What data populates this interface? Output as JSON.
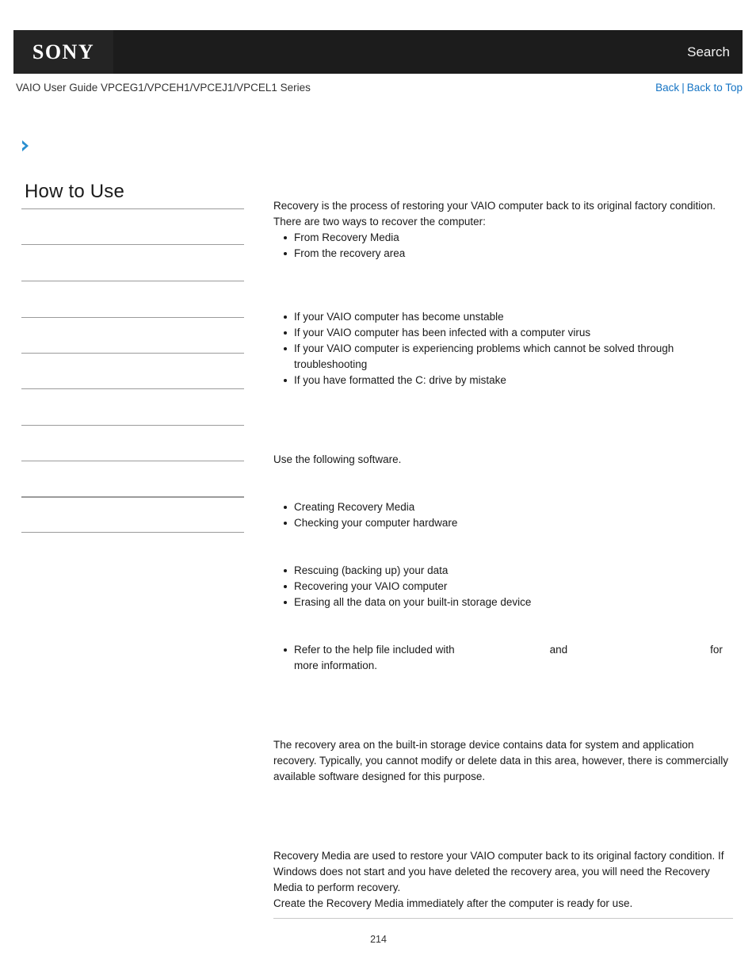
{
  "header": {
    "logo": "SONY",
    "search_label": "Search",
    "logo_icon": "sony-logo"
  },
  "subheader": {
    "guide_title": "VAIO User Guide VPCEG1/VPCEH1/VPCEJ1/VPCEL1 Series",
    "back_label": "Back",
    "separator": "|",
    "back_to_top_label": "Back to Top"
  },
  "breadcrumb": {
    "icon": "chevron-right-icon",
    "text": "",
    "accent_color": "#2a8fd0"
  },
  "sidebar": {
    "heading": "How to Use",
    "items": [
      {
        "label": "",
        "thick": false
      },
      {
        "label": "",
        "thick": false
      },
      {
        "label": "",
        "thick": false
      },
      {
        "label": "",
        "thick": false
      },
      {
        "label": "",
        "thick": false
      },
      {
        "label": "",
        "thick": false
      },
      {
        "label": "",
        "thick": false
      },
      {
        "label": "",
        "thick": false
      },
      {
        "label": "",
        "thick": true
      },
      {
        "label": "",
        "thick": false
      }
    ]
  },
  "content": {
    "intro": {
      "line1": "Recovery is the process of restoring your VAIO computer back to its original factory condition.",
      "line2": "There are two ways to recover the computer:",
      "bullets": [
        "From Recovery Media",
        "From the recovery area"
      ]
    },
    "when_section": {
      "title": "",
      "bullets": [
        "If your VAIO computer has become unstable",
        "If your VAIO computer has been infected with a computer virus",
        "If your VAIO computer is experiencing problems which cannot be solved through troubleshooting",
        "If you have formatted the C: drive by mistake"
      ]
    },
    "software_section": {
      "title": "",
      "lead": "Use the following software.",
      "group1_title": "",
      "group1_bullets": [
        "Creating Recovery Media",
        "Checking your computer hardware"
      ],
      "group2_title": "",
      "group2_bullets": [
        "Rescuing (backing up) your data",
        "Recovering your VAIO computer",
        "Erasing all the data on your built-in storage device"
      ],
      "note_title": "",
      "note_prefix": "Refer to the help file included with",
      "note_blank1": "",
      "note_conjunction": "and",
      "note_blank2": "",
      "note_suffix": "for more information."
    },
    "recovery_area_section": {
      "title": "",
      "text": "The recovery area on the built-in storage device contains data for system and application recovery. Typically, you cannot modify or delete data in this area, however, there is commercially available software designed for this purpose."
    },
    "recovery_media_section": {
      "title": "",
      "line1": "Recovery Media are used to restore your VAIO computer back to its original factory condition. If Windows does not start and you have deleted the recovery area, you will need the Recovery Media to perform recovery.",
      "line2": "Create the Recovery Media immediately after the computer is ready for use."
    }
  },
  "footer": {
    "page_number": "214"
  }
}
